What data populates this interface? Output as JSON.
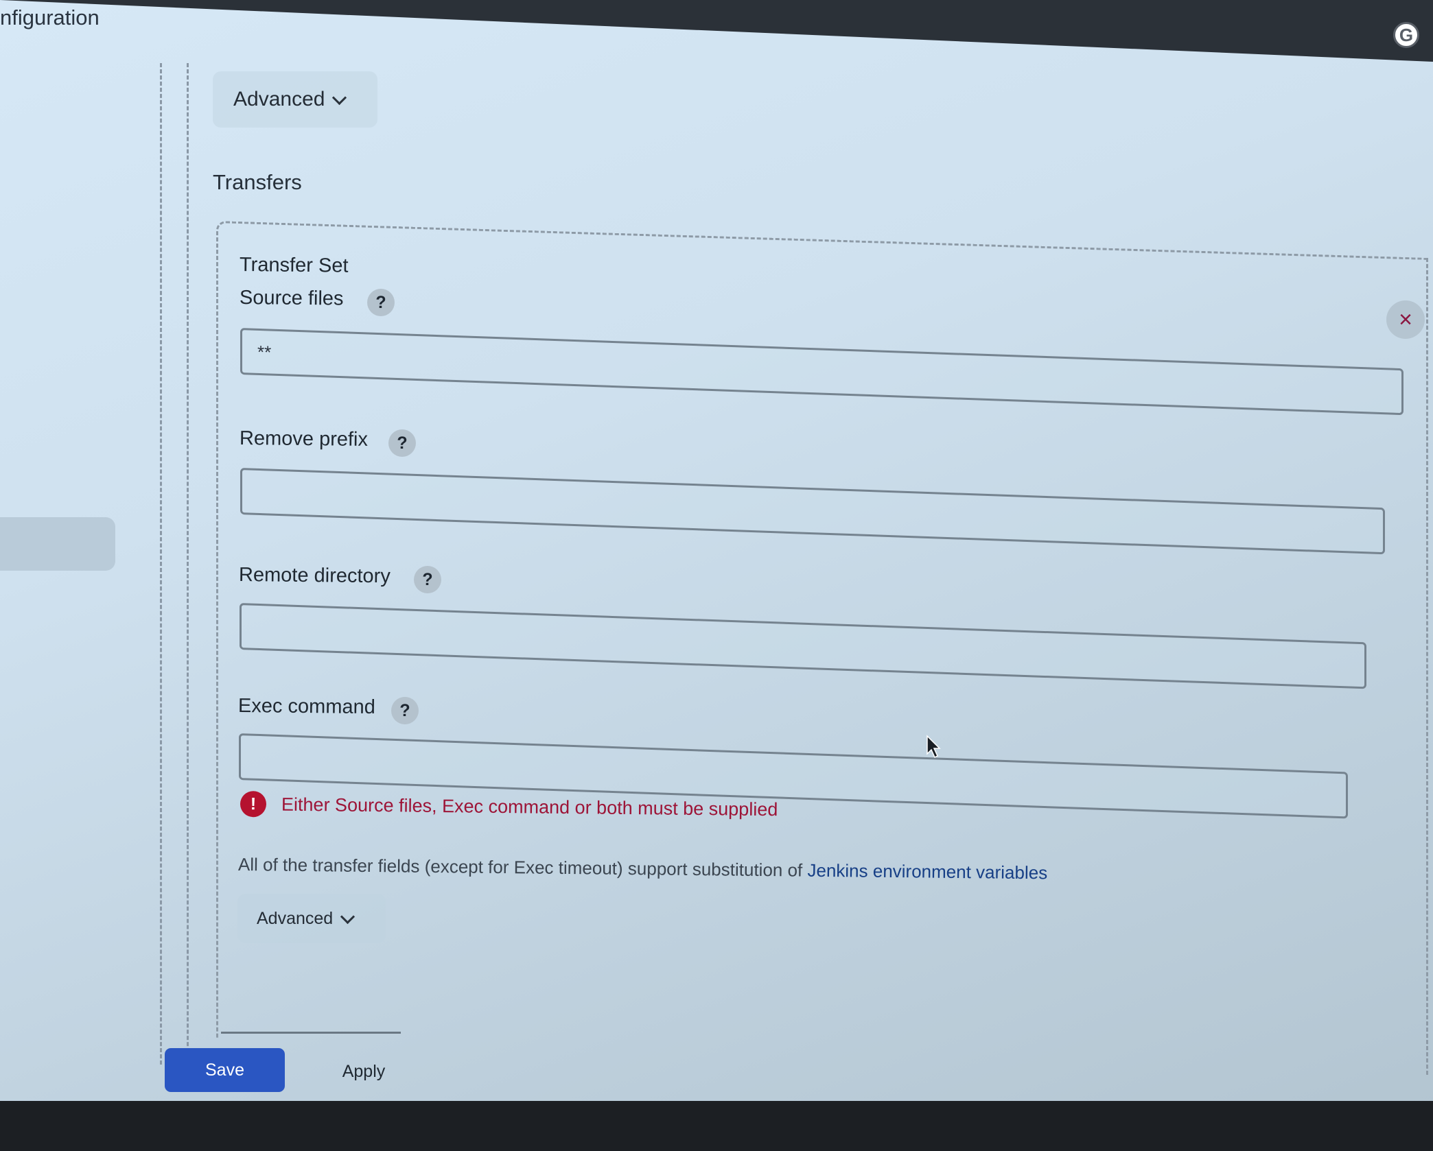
{
  "window": {
    "title": "nfiguration"
  },
  "advanced_top": {
    "label": "Advanced"
  },
  "section": {
    "title": "Transfers"
  },
  "transfer_set": {
    "title": "Transfer Set",
    "close_label": "×",
    "fields": {
      "source_files": {
        "label": "Source files",
        "value": "**"
      },
      "remove_prefix": {
        "label": "Remove prefix",
        "value": ""
      },
      "remote_directory": {
        "label": "Remote directory",
        "value": ""
      },
      "exec_command": {
        "label": "Exec command",
        "value": ""
      }
    },
    "help_label": "?",
    "error": {
      "icon": "!",
      "text": "Either Source files, Exec command or both must be supplied"
    },
    "info": {
      "text": "All of the transfer fields (except for Exec timeout) support substitution of ",
      "link": "Jenkins environment variables"
    },
    "advanced": {
      "label": "Advanced"
    }
  },
  "footer": {
    "save_label": "Save",
    "apply_label": "Apply"
  },
  "colors": {
    "primary": "#2a56c2",
    "error": "#9d1437",
    "link": "#173f86"
  }
}
